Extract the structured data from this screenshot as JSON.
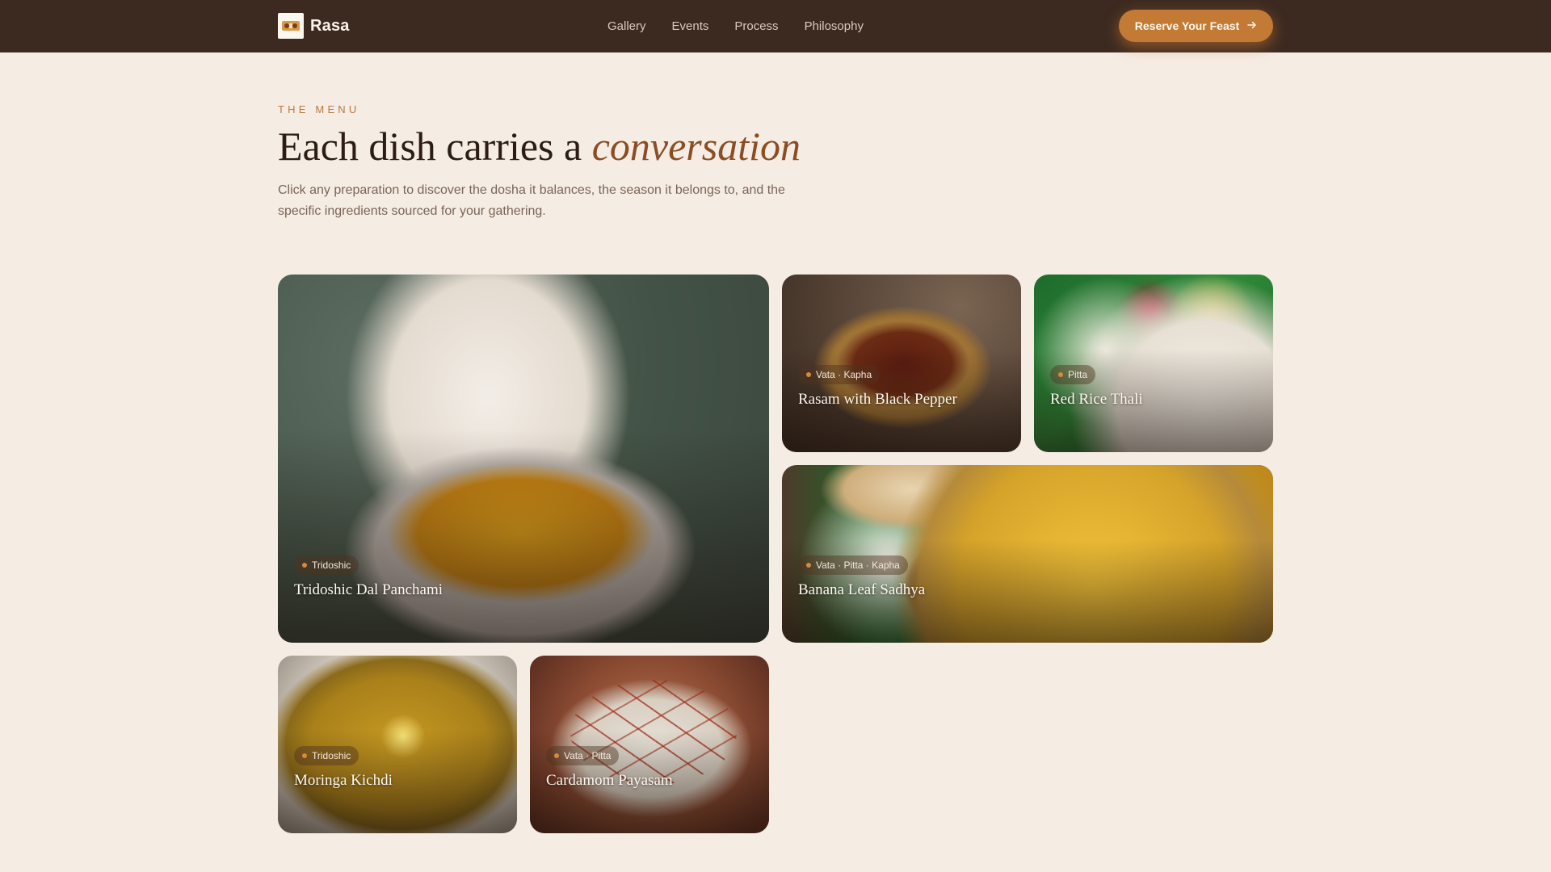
{
  "header": {
    "brand_name": "Rasa",
    "nav": [
      "Gallery",
      "Events",
      "Process",
      "Philosophy"
    ],
    "cta_label": "Reserve Your Feast",
    "cta_icon": "arrow-right-icon"
  },
  "intro": {
    "eyebrow": "THE MENU",
    "headline_lead": "Each dish carries a ",
    "headline_emphasis": "conversation",
    "description": "Click any preparation to discover the dosha it balances, the season it belongs to, and the specific ingredients sourced for your gathering."
  },
  "dishes": [
    {
      "title": "Tridoshic Dal Panchami",
      "dosha": "Tridoshic"
    },
    {
      "title": "Rasam with Black Pepper",
      "dosha": "Vata · Kapha"
    },
    {
      "title": "Red Rice Thali",
      "dosha": "Pitta"
    },
    {
      "title": "Banana Leaf Sadhya",
      "dosha": "Vata · Pitta · Kapha"
    },
    {
      "title": "Moringa Kichdi",
      "dosha": "Tridoshic"
    },
    {
      "title": "Cardamom Payasam",
      "dosha": "Vata · Pitta"
    }
  ],
  "colors": {
    "header_bg": "#3c2a20",
    "page_bg": "#f5ece4",
    "accent": "#c27a34",
    "headline_emphasis": "#8a4d24"
  }
}
